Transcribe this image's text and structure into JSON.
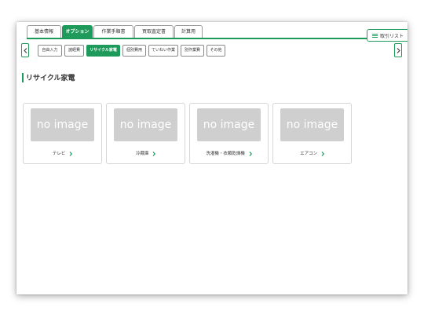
{
  "main_tabs": [
    {
      "label": "基本情報",
      "active": false
    },
    {
      "label": "オプション",
      "active": true
    },
    {
      "label": "作業手順書",
      "active": false
    },
    {
      "label": "買取査定書",
      "active": false
    },
    {
      "label": "計算用",
      "active": false
    }
  ],
  "torihiki_list_label": "取引リスト",
  "sub_tabs": [
    {
      "label": "自由入力",
      "active": false
    },
    {
      "label": "諸経費",
      "active": false
    },
    {
      "label": "リサイクル家電",
      "active": true
    },
    {
      "label": "個別費用",
      "active": false
    },
    {
      "label": "ていねい作業",
      "active": false
    },
    {
      "label": "別作業費",
      "active": false
    },
    {
      "label": "その他",
      "active": false
    }
  ],
  "page_title": "リサイクル家電",
  "cards": [
    {
      "image_text": "no image",
      "label": "テレビ"
    },
    {
      "image_text": "no image",
      "label": "冷蔵庫"
    },
    {
      "image_text": "no image",
      "label": "洗濯機・衣類乾燥機"
    },
    {
      "image_text": "no image",
      "label": "エアコン"
    }
  ],
  "colors": {
    "accent": "#1e9a5a",
    "placeholder_gray": "#cfcfcf"
  },
  "icons": {
    "menu": "hamburger-icon",
    "prev": "chevron-left-icon",
    "next": "chevron-right-icon"
  }
}
